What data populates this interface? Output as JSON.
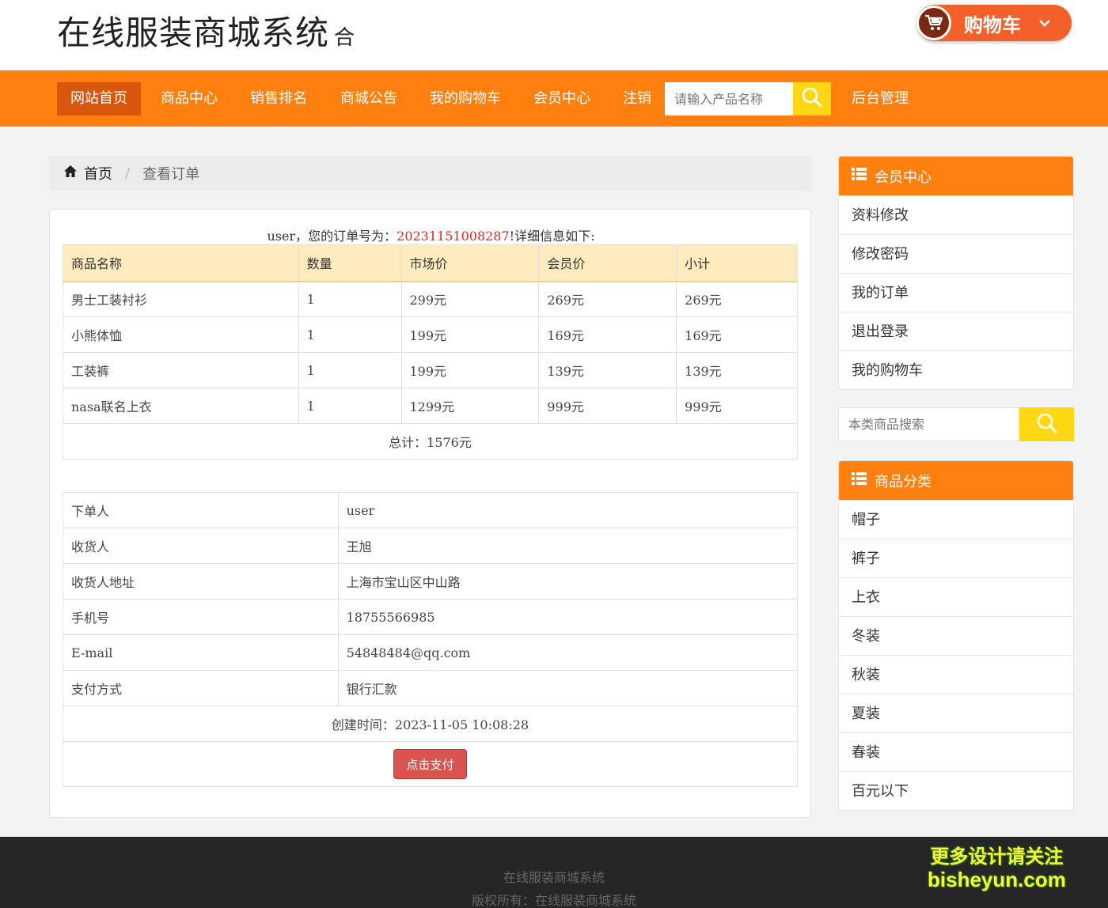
{
  "header": {
    "site_title": "在线服装商城系统",
    "title_suffix": "合",
    "cart_label": "购物车"
  },
  "nav": {
    "items": [
      "网站首页",
      "商品中心",
      "销售排名",
      "商城公告",
      "我的购物车",
      "会员中心",
      "注销"
    ],
    "active_index": 0,
    "search_placeholder": "请输入产品名称",
    "admin_label": "后台管理"
  },
  "breadcrumb": {
    "home": "首页",
    "separator": "/",
    "current": "查看订单"
  },
  "order": {
    "intro_user": "user，您的订单号为：",
    "order_no": "20231151008287",
    "intro_suffix": "!详细信息如下:",
    "columns": [
      "商品名称",
      "数量",
      "市场价",
      "会员价",
      "小计"
    ],
    "rows": [
      [
        "男士工装衬衫",
        "1",
        "299元",
        "269元",
        "269元"
      ],
      [
        "小熊体恤",
        "1",
        "199元",
        "169元",
        "169元"
      ],
      [
        "工装裤",
        "1",
        "199元",
        "139元",
        "139元"
      ],
      [
        "nasa联名上衣",
        "1",
        "1299元",
        "999元",
        "999元"
      ]
    ],
    "total": "总计：1576元",
    "info": [
      [
        "下单人",
        "user"
      ],
      [
        "收货人",
        "王旭"
      ],
      [
        "收货人地址",
        "上海市宝山区中山路"
      ],
      [
        "手机号",
        "18755566985"
      ],
      [
        "E-mail",
        "54848484@qq.com"
      ],
      [
        "支付方式",
        "银行汇款"
      ]
    ],
    "created": "创建时间：2023-11-05 10:08:28",
    "pay_button": "点击支付"
  },
  "sidebar": {
    "member_title": "会员中心",
    "member_items": [
      "资料修改",
      "修改密码",
      "我的订单",
      "退出登录",
      "我的购物车"
    ],
    "search_placeholder": "本类商品搜索",
    "category_title": "商品分类",
    "category_items": [
      "帽子",
      "裤子",
      "上衣",
      "冬装",
      "秋装",
      "夏装",
      "春装",
      "百元以下"
    ]
  },
  "footer": {
    "line1": "在线服装商城系统",
    "line2": "版权所有：在线服装商城系统"
  },
  "watermark": {
    "line1": "更多设计请关注",
    "line2": "bisheyun.com"
  },
  "colors": {
    "brand_orange": "#ff7f0f",
    "nav_active": "#d9570d",
    "search_yellow": "#ffd712",
    "table_header": "#fdebbd",
    "order_no_red": "#e32424",
    "pay_red": "#d9534f",
    "footer_bg": "#262626"
  },
  "icons": {
    "cart": "cart-icon",
    "search": "search-icon",
    "home": "home-icon",
    "list": "list-icon",
    "chevron": "chevron-down-icon"
  }
}
